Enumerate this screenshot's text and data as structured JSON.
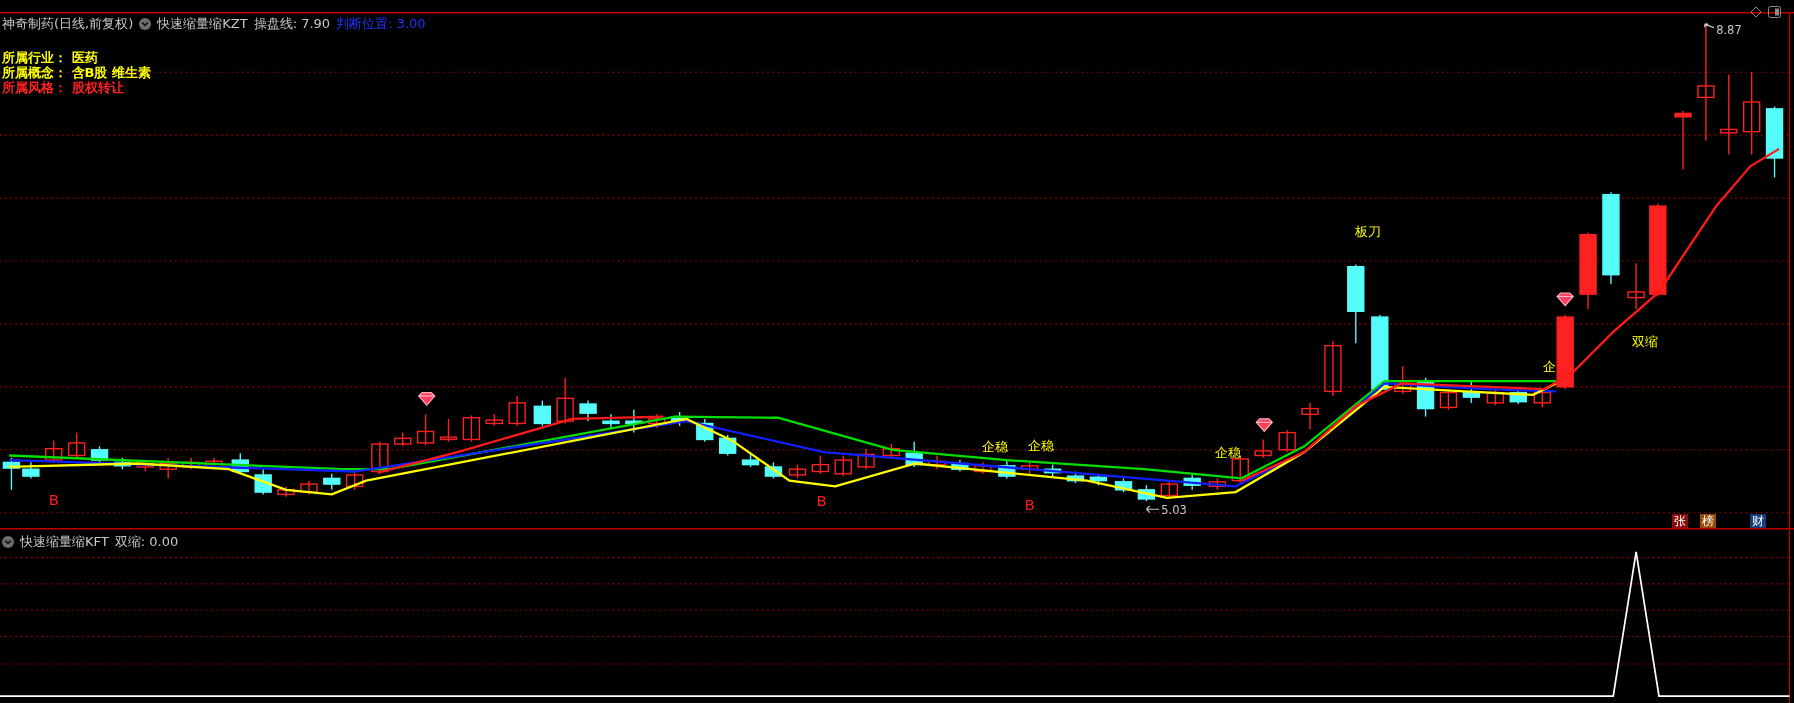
{
  "header": {
    "title": "神奇制药(日线,前复权)",
    "indicator": "快速缩量缩KZT",
    "readings": [
      {
        "text": "操盘线: 7.90",
        "color": "#c8c8c8"
      },
      {
        "text": "判断位置: 3.00",
        "color": "#2233ff"
      }
    ]
  },
  "info": [
    {
      "text": "所属行业： 医药",
      "color": "#ffff00"
    },
    {
      "text": "所属概念： 含B股 维生素",
      "color": "#ffff00"
    },
    {
      "text": "所属风格： 股权转让",
      "color": "#ff2020"
    }
  ],
  "chart_labels": [
    {
      "kind": "signal",
      "text": "B"
    },
    {
      "kind": "signal",
      "text": "B"
    },
    {
      "kind": "signal",
      "text": "B"
    },
    {
      "kind": "note",
      "text": "企稳"
    },
    {
      "kind": "note",
      "text": "企稳"
    },
    {
      "kind": "note",
      "text": "企稳"
    },
    {
      "kind": "note",
      "text": "企"
    },
    {
      "kind": "note",
      "text": "板刀"
    },
    {
      "kind": "note",
      "text": "双缩"
    }
  ],
  "price_marks": [
    {
      "kind": "high",
      "text": "8.87"
    },
    {
      "kind": "low",
      "text": "5.03"
    }
  ],
  "badges": [
    {
      "text": "张",
      "color": "#8a0c0c"
    },
    {
      "text": "榜",
      "color": "#9a4a08"
    },
    {
      "text": "财",
      "color": "#143e78"
    }
  ],
  "sub_pane": {
    "indicator": "快速缩量缩KFT",
    "readings": [
      {
        "text": "双缩: 0.00",
        "color": "#c8c8c8"
      }
    ]
  }
}
